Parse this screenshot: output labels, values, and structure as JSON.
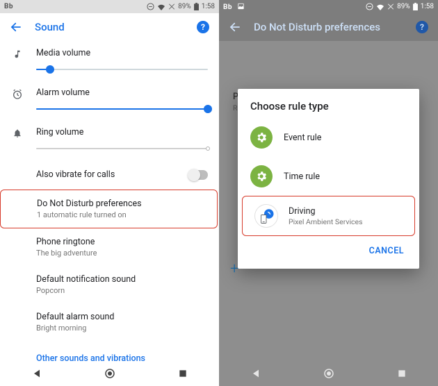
{
  "left": {
    "status": {
      "bb": "Bb",
      "percent": "89%",
      "time": "1:58"
    },
    "appbar": {
      "title": "Sound"
    },
    "media": {
      "label": "Media volume",
      "value": 0.08
    },
    "alarm": {
      "label": "Alarm volume",
      "value": 1.0
    },
    "ring": {
      "label": "Ring volume"
    },
    "vibrate": {
      "label": "Also vibrate for calls"
    },
    "dnd": {
      "label": "Do Not Disturb preferences",
      "sub": "1 automatic rule turned on"
    },
    "ringtone": {
      "label": "Phone ringtone",
      "sub": "The big adventure"
    },
    "notif": {
      "label": "Default notification sound",
      "sub": "Popcorn"
    },
    "alarm_sound": {
      "label": "Default alarm sound",
      "sub": "Bright morning"
    },
    "other": {
      "label": "Other sounds and vibrations"
    }
  },
  "right": {
    "status": {
      "bb": "Bb",
      "percent": "89%",
      "time": "1:58"
    },
    "appbar": {
      "title": "Do Not Disturb preferences"
    },
    "priority": {
      "label": "Priority only allows",
      "sub": "Reminders, Events, Alarms, Selected callers"
    },
    "dialog": {
      "title": "Choose rule type",
      "event": "Event rule",
      "time": "Time rule",
      "driving": {
        "t1": "Driving",
        "t2": "Pixel Ambient Services"
      },
      "cancel": "CANCEL"
    }
  }
}
